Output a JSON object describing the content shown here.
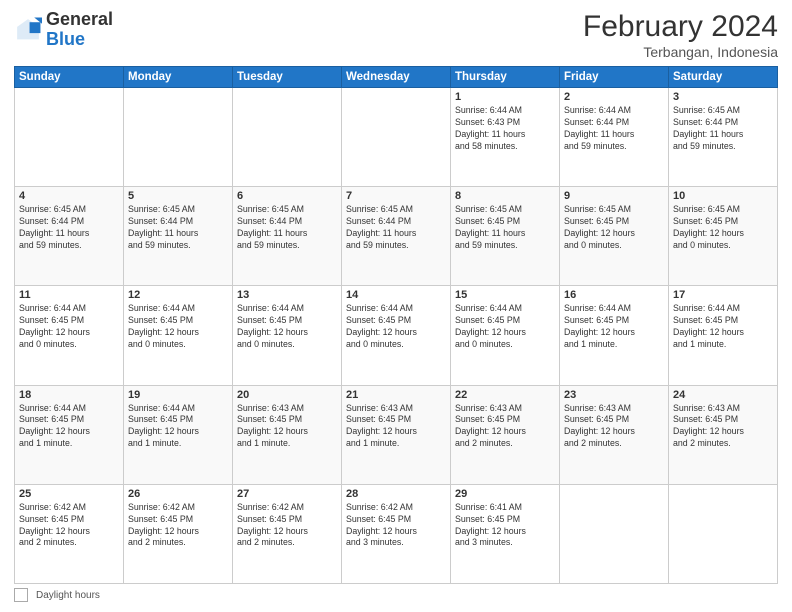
{
  "header": {
    "logo_general": "General",
    "logo_blue": "Blue",
    "month_year": "February 2024",
    "location": "Terbangan, Indonesia"
  },
  "footer": {
    "label": "Daylight hours"
  },
  "days_of_week": [
    "Sunday",
    "Monday",
    "Tuesday",
    "Wednesday",
    "Thursday",
    "Friday",
    "Saturday"
  ],
  "weeks": [
    [
      {
        "day": "",
        "info": ""
      },
      {
        "day": "",
        "info": ""
      },
      {
        "day": "",
        "info": ""
      },
      {
        "day": "",
        "info": ""
      },
      {
        "day": "1",
        "info": "Sunrise: 6:44 AM\nSunset: 6:43 PM\nDaylight: 11 hours\nand 58 minutes."
      },
      {
        "day": "2",
        "info": "Sunrise: 6:44 AM\nSunset: 6:44 PM\nDaylight: 11 hours\nand 59 minutes."
      },
      {
        "day": "3",
        "info": "Sunrise: 6:45 AM\nSunset: 6:44 PM\nDaylight: 11 hours\nand 59 minutes."
      }
    ],
    [
      {
        "day": "4",
        "info": "Sunrise: 6:45 AM\nSunset: 6:44 PM\nDaylight: 11 hours\nand 59 minutes."
      },
      {
        "day": "5",
        "info": "Sunrise: 6:45 AM\nSunset: 6:44 PM\nDaylight: 11 hours\nand 59 minutes."
      },
      {
        "day": "6",
        "info": "Sunrise: 6:45 AM\nSunset: 6:44 PM\nDaylight: 11 hours\nand 59 minutes."
      },
      {
        "day": "7",
        "info": "Sunrise: 6:45 AM\nSunset: 6:44 PM\nDaylight: 11 hours\nand 59 minutes."
      },
      {
        "day": "8",
        "info": "Sunrise: 6:45 AM\nSunset: 6:45 PM\nDaylight: 11 hours\nand 59 minutes."
      },
      {
        "day": "9",
        "info": "Sunrise: 6:45 AM\nSunset: 6:45 PM\nDaylight: 12 hours\nand 0 minutes."
      },
      {
        "day": "10",
        "info": "Sunrise: 6:45 AM\nSunset: 6:45 PM\nDaylight: 12 hours\nand 0 minutes."
      }
    ],
    [
      {
        "day": "11",
        "info": "Sunrise: 6:44 AM\nSunset: 6:45 PM\nDaylight: 12 hours\nand 0 minutes."
      },
      {
        "day": "12",
        "info": "Sunrise: 6:44 AM\nSunset: 6:45 PM\nDaylight: 12 hours\nand 0 minutes."
      },
      {
        "day": "13",
        "info": "Sunrise: 6:44 AM\nSunset: 6:45 PM\nDaylight: 12 hours\nand 0 minutes."
      },
      {
        "day": "14",
        "info": "Sunrise: 6:44 AM\nSunset: 6:45 PM\nDaylight: 12 hours\nand 0 minutes."
      },
      {
        "day": "15",
        "info": "Sunrise: 6:44 AM\nSunset: 6:45 PM\nDaylight: 12 hours\nand 0 minutes."
      },
      {
        "day": "16",
        "info": "Sunrise: 6:44 AM\nSunset: 6:45 PM\nDaylight: 12 hours\nand 1 minute."
      },
      {
        "day": "17",
        "info": "Sunrise: 6:44 AM\nSunset: 6:45 PM\nDaylight: 12 hours\nand 1 minute."
      }
    ],
    [
      {
        "day": "18",
        "info": "Sunrise: 6:44 AM\nSunset: 6:45 PM\nDaylight: 12 hours\nand 1 minute."
      },
      {
        "day": "19",
        "info": "Sunrise: 6:44 AM\nSunset: 6:45 PM\nDaylight: 12 hours\nand 1 minute."
      },
      {
        "day": "20",
        "info": "Sunrise: 6:43 AM\nSunset: 6:45 PM\nDaylight: 12 hours\nand 1 minute."
      },
      {
        "day": "21",
        "info": "Sunrise: 6:43 AM\nSunset: 6:45 PM\nDaylight: 12 hours\nand 1 minute."
      },
      {
        "day": "22",
        "info": "Sunrise: 6:43 AM\nSunset: 6:45 PM\nDaylight: 12 hours\nand 2 minutes."
      },
      {
        "day": "23",
        "info": "Sunrise: 6:43 AM\nSunset: 6:45 PM\nDaylight: 12 hours\nand 2 minutes."
      },
      {
        "day": "24",
        "info": "Sunrise: 6:43 AM\nSunset: 6:45 PM\nDaylight: 12 hours\nand 2 minutes."
      }
    ],
    [
      {
        "day": "25",
        "info": "Sunrise: 6:42 AM\nSunset: 6:45 PM\nDaylight: 12 hours\nand 2 minutes."
      },
      {
        "day": "26",
        "info": "Sunrise: 6:42 AM\nSunset: 6:45 PM\nDaylight: 12 hours\nand 2 minutes."
      },
      {
        "day": "27",
        "info": "Sunrise: 6:42 AM\nSunset: 6:45 PM\nDaylight: 12 hours\nand 2 minutes."
      },
      {
        "day": "28",
        "info": "Sunrise: 6:42 AM\nSunset: 6:45 PM\nDaylight: 12 hours\nand 3 minutes."
      },
      {
        "day": "29",
        "info": "Sunrise: 6:41 AM\nSunset: 6:45 PM\nDaylight: 12 hours\nand 3 minutes."
      },
      {
        "day": "",
        "info": ""
      },
      {
        "day": "",
        "info": ""
      }
    ]
  ]
}
